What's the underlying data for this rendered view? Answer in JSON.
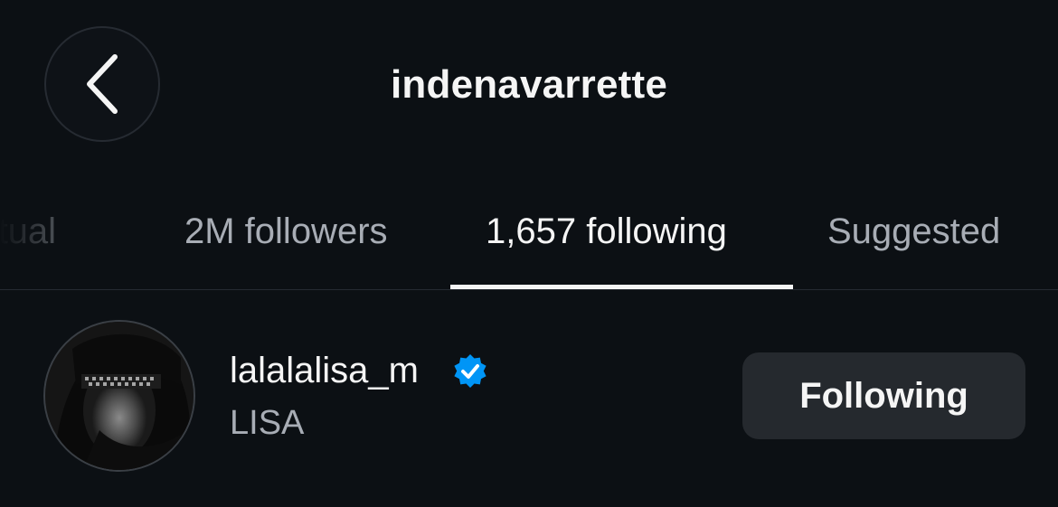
{
  "header": {
    "title": "indenavarrette",
    "back_icon": "chevron-left-icon"
  },
  "tabs": [
    {
      "label": "Mutual",
      "active": false
    },
    {
      "label": "2M followers",
      "active": false
    },
    {
      "label": "1,657 following",
      "active": true
    },
    {
      "label": "Suggested",
      "active": false
    }
  ],
  "users": [
    {
      "username": "lalalalisa_m",
      "full_name": "LISA",
      "verified": true,
      "verified_icon": "verified-badge-icon",
      "button_label": "Following"
    }
  ],
  "colors": {
    "background": "#0c1014",
    "text_primary": "#f5f5f5",
    "text_secondary": "#a8adb5",
    "button_bg": "#25292e",
    "verified_blue": "#0095f6"
  }
}
